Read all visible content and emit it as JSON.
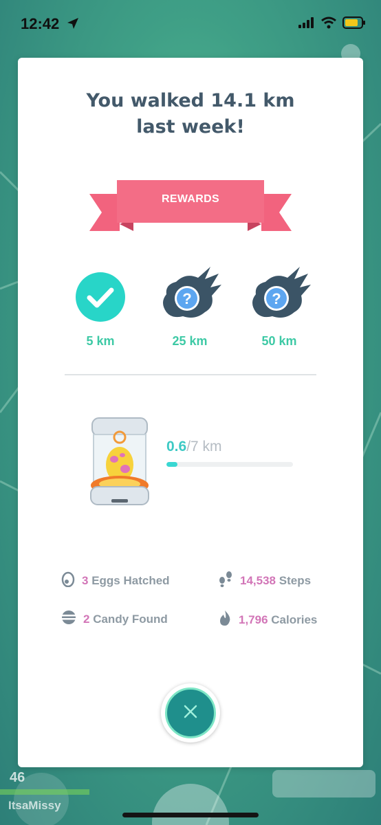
{
  "status_bar": {
    "time": "12:42",
    "icons": [
      "location-arrow-icon",
      "cellular-signal-icon",
      "wifi-icon",
      "battery-icon"
    ],
    "battery_color": "#f2c71b"
  },
  "summary": {
    "headline_line1": "You walked 14.1 km",
    "headline_line2": "last week!"
  },
  "rewards": {
    "banner_label": "REWARDS",
    "banner_color": "#f2637e",
    "items": [
      {
        "label": "5 km",
        "state": "completed",
        "icon": "checkmark-circle-icon"
      },
      {
        "label": "25 km",
        "state": "locked",
        "icon": "mystery-reward-icon"
      },
      {
        "label": "50 km",
        "state": "locked",
        "icon": "mystery-reward-icon"
      }
    ]
  },
  "egg": {
    "current": "0.6",
    "total": "/7 km",
    "progress_fraction": 0.086,
    "icon": "egg-incubator-icon"
  },
  "stats": {
    "eggs_hatched": {
      "num": "3",
      "label": "Eggs Hatched",
      "icon": "egg-icon"
    },
    "steps": {
      "num": "14,538",
      "label": "Steps",
      "icon": "footprints-icon"
    },
    "candy": {
      "num": "2",
      "label": "Candy Found",
      "icon": "candy-icon"
    },
    "calories": {
      "num": "1,796",
      "label": "Calories",
      "icon": "flame-icon"
    }
  },
  "close_button": {
    "icon": "close-icon"
  },
  "player": {
    "level": "46",
    "name": "ItsaMissy"
  },
  "colors": {
    "accent_teal": "#3dc9a5",
    "stat_number": "#d275b7",
    "headline": "#43596a"
  }
}
